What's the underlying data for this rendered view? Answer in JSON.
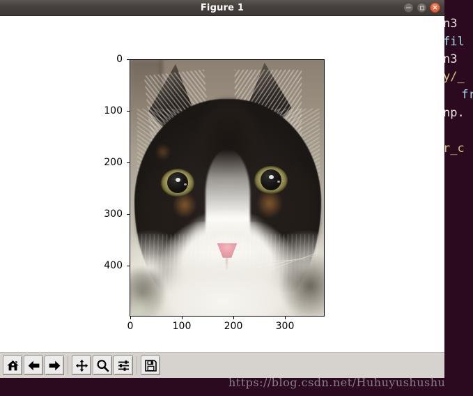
{
  "window": {
    "title": "Figure 1",
    "controls": [
      {
        "name": "minimize",
        "glyph": "–"
      },
      {
        "name": "maximize",
        "glyph": "□"
      },
      {
        "name": "close",
        "glyph": "×"
      }
    ]
  },
  "figure": {
    "axes": {
      "xticks": [
        "0",
        "100",
        "200",
        "300"
      ],
      "yticks": [
        "0",
        "100",
        "200",
        "300",
        "400"
      ],
      "xlim": [
        -0.5,
        378
      ],
      "ylim": [
        497,
        -0.5
      ],
      "image_alt": "photograph of a long-haired tuxedo/calico cat facing the camera"
    }
  },
  "chart_data": {
    "type": "image",
    "title": "",
    "xlabel": "",
    "ylabel": "",
    "x_tick_labels": [
      "0",
      "100",
      "200",
      "300"
    ],
    "x_tick_values": [
      0,
      100,
      200,
      300
    ],
    "y_tick_labels": [
      "0",
      "100",
      "200",
      "300",
      "400"
    ],
    "y_tick_values": [
      0,
      100,
      200,
      300,
      400
    ],
    "xlim": [
      0,
      378
    ],
    "ylim": [
      497,
      0
    ],
    "grid": false,
    "legend": null,
    "content": "RGB image array of a cat displayed with matplotlib imshow; pixel coordinates on both axes, origin at top-left"
  },
  "toolbar": {
    "buttons": [
      {
        "name": "home-button",
        "tip": "Reset original view",
        "icon": "home-icon"
      },
      {
        "name": "back-button",
        "tip": "Back to previous view",
        "icon": "arrow-left-icon"
      },
      {
        "name": "forward-button",
        "tip": "Forward to next view",
        "icon": "arrow-right-icon"
      },
      {
        "name": "pan-button",
        "tip": "Pan axes with left mouse, zoom with right",
        "icon": "move-icon"
      },
      {
        "name": "zoom-button",
        "tip": "Zoom to rectangle",
        "icon": "magnifier-icon"
      },
      {
        "name": "subplots-button",
        "tip": "Configure subplots",
        "icon": "sliders-icon"
      },
      {
        "name": "save-button",
        "tip": "Save the figure",
        "icon": "floppy-disk-icon"
      }
    ]
  },
  "terminal": {
    "lines": [
      {
        "text": "n3 ",
        "color": "white"
      },
      {
        "text": "fil",
        "color": "cyan"
      },
      {
        "text": "n3 ",
        "color": "white"
      },
      {
        "text": "y/_",
        "color": "yellow"
      },
      {
        "text": " fr",
        "color": "cyan"
      },
      {
        "text": "np.",
        "color": "white"
      },
      {
        "text": "r_c",
        "color": "yellow"
      }
    ]
  },
  "watermark": {
    "text": "https://blog.csdn.net/Huhuyushushu"
  },
  "colors": {
    "titlebar": "#45403d",
    "close_button": "#d5492b",
    "canvas": "#ffffff",
    "toolbar": "#d6d3ce",
    "terminal_bg": "#2b0a20",
    "watermark": "#8c7d86"
  }
}
